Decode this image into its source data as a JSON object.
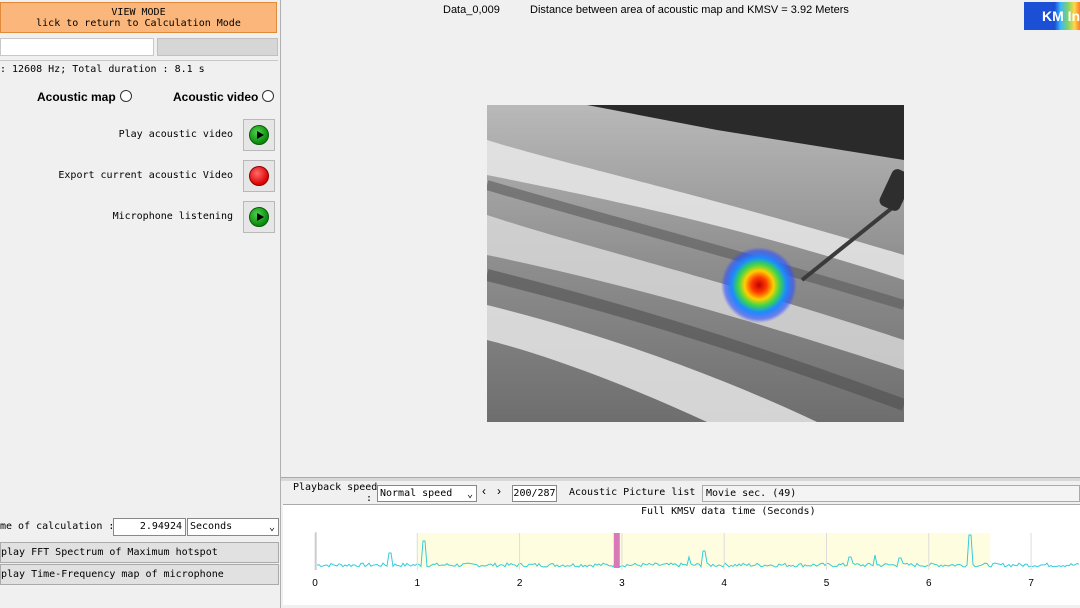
{
  "left_panel": {
    "view_mode_title": "VIEW MODE",
    "view_mode_hint": "lick to return to Calculation Mode",
    "info_line": ": 12608 Hz;  Total duration : 8.1 s",
    "radio_acoustic_map": "Acoustic map",
    "radio_acoustic_video": "Acoustic video",
    "actions": [
      {
        "label": "Play acoustic video",
        "icon": "play-icon"
      },
      {
        "label": "Export current acoustic Video",
        "icon": "record-icon"
      },
      {
        "label": "Microphone listening",
        "icon": "play-icon"
      }
    ],
    "calc_label": "me of calculation :",
    "calc_value": "2.94924",
    "calc_unit": "Seconds",
    "btn_fft": "play FFT Spectrum of Maximum hotspot",
    "btn_tf": "play Time-Frequency map of microphone"
  },
  "header": {
    "data_name": "Data_0,009",
    "distance_text": "Distance between area of acoustic map and KMSV = 3.92 Meters",
    "logo_text": "KM In"
  },
  "playback": {
    "speed_label_1": "Playback speed",
    "speed_label_2": ":",
    "speed_value": "Normal speed",
    "frame": "200/287",
    "picture_list": "Acoustic Picture list",
    "movie_sec": "Movie sec. (49)"
  },
  "timeline": {
    "title": "Full KMSV data time  (Seconds)",
    "ticks": [
      "0",
      "1",
      "2",
      "3",
      "4",
      "5",
      "6",
      "7"
    ],
    "cursor_seconds": 2.95,
    "highlight_range": [
      1,
      6.6
    ],
    "colors": {
      "signal": "#33ccdd",
      "highlight": "#fffde0",
      "cursor": "#d87ab8"
    }
  }
}
